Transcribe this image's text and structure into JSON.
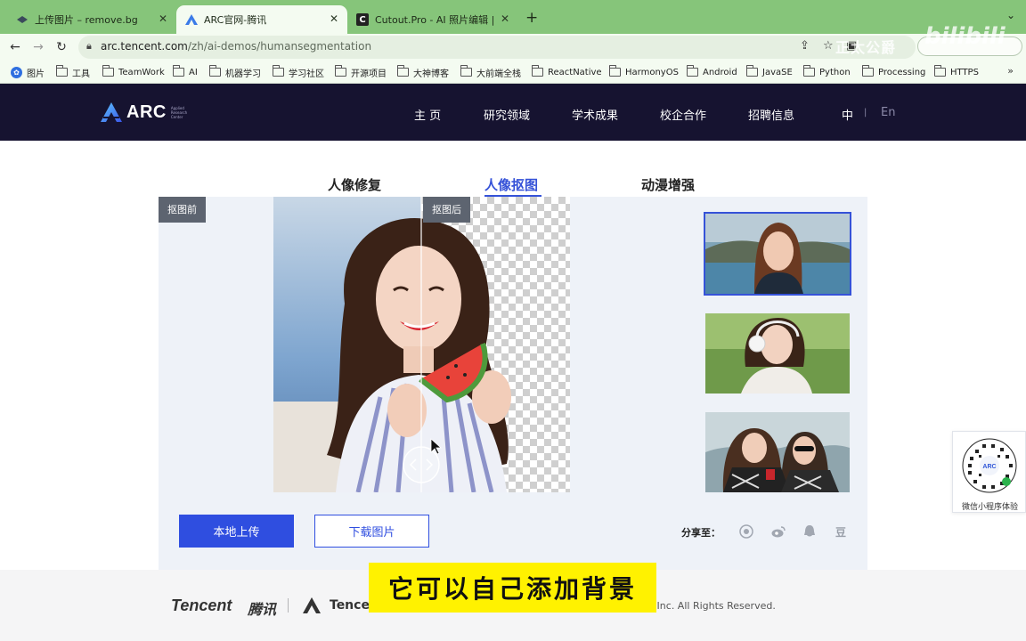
{
  "browser": {
    "tabs": [
      {
        "title": "上传图片 – remove.bg",
        "favicon": "remove-bg-icon"
      },
      {
        "title": "ARC官网-腾讯",
        "favicon": "arc-logo-icon"
      },
      {
        "title": "Cutout.Pro - AI 照片编辑 | 视频",
        "favicon": "cutout-c-icon"
      }
    ],
    "url_host": "arc.tencent.com",
    "url_path": "/zh/ai-demos/humansegmentation",
    "watermark": "正太公爵",
    "bookmarks": [
      "图片",
      "工具",
      "TeamWork",
      "AI",
      "机器学习",
      "学习社区",
      "开源项目",
      "大神博客",
      "大前端全栈",
      "ReactNative",
      "HarmonyOS",
      "Android",
      "JavaSE",
      "Python",
      "Processing",
      "HTTPS"
    ],
    "bookmarks_more": "»"
  },
  "site": {
    "logo_text": "ARC",
    "logo_subtext": "Applied Research Center",
    "nav": [
      "主 页",
      "研究领域",
      "学术成果",
      "校企合作",
      "招聘信息"
    ],
    "lang_zh": "中",
    "lang_sep": "|",
    "lang_en": "En",
    "brand_color": "#161330",
    "accent_color": "#3552d8"
  },
  "demo": {
    "tabs": [
      "人像修复",
      "人像抠图",
      "动漫增强"
    ],
    "active_tab": "人像抠图",
    "before_label": "抠图前",
    "after_label": "抠图后",
    "upload_button": "本地上传",
    "download_button": "下载图片",
    "share_label": "分享至：",
    "share_icons": [
      "wechat-icon",
      "weibo-icon",
      "qq-icon",
      "douban-icon"
    ],
    "douban_glyph": "豆",
    "qr_caption": "微信小程序体验"
  },
  "footer": {
    "tencent_en": "Tencent",
    "tencent_cn": "腾讯",
    "brand_partial": "Tencen",
    "copyright_partial": "ent Inc. All Rights Reserved."
  },
  "video_subtitle": "它可以自己添加背景"
}
